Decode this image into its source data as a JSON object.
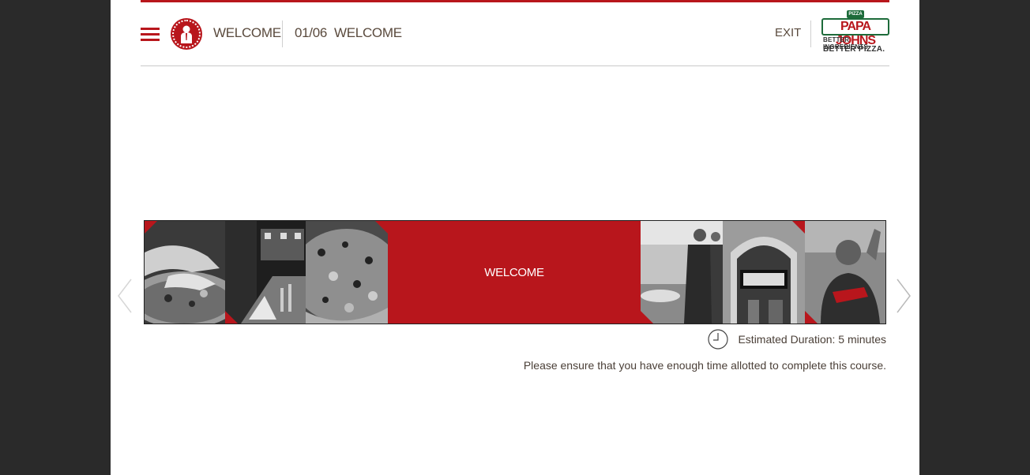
{
  "header": {
    "section_title": "WELCOME",
    "page_number": "01/06",
    "page_title": "WELCOME",
    "exit_label": "EXIT"
  },
  "logo": {
    "badge": "PIZZA",
    "brand": "PAPA JOHNS",
    "tagline_1": "BETTER INGREDIENTS.",
    "tagline_2": "BETTER PIZZA."
  },
  "strip": {
    "center_label": "WELCOME",
    "tiles": [
      {
        "content": "hands-topping-pizza-photo"
      },
      {
        "content": "restaurant-interior-photo"
      },
      {
        "content": "pizza-closeup-photo"
      },
      {
        "content": "welcome-label"
      },
      {
        "content": "staff-at-counter-photo"
      },
      {
        "content": "storefront-photo"
      },
      {
        "content": "founder-thumbs-up-photo"
      }
    ]
  },
  "info": {
    "duration": "Estimated Duration: 5 minutes",
    "notice": "Please ensure that you have enough time allotted to complete this course."
  },
  "colors": {
    "brand_red": "#b8161c",
    "brand_green": "#1d6b3a",
    "text_brown": "#5a4a3d",
    "outer_background": "#2a2a2a"
  },
  "icons": {
    "menu": "hamburger-menu-icon",
    "avatar": "founder-seal-icon",
    "prev": "chevron-left-icon",
    "next": "chevron-right-icon",
    "clock": "clock-icon"
  }
}
